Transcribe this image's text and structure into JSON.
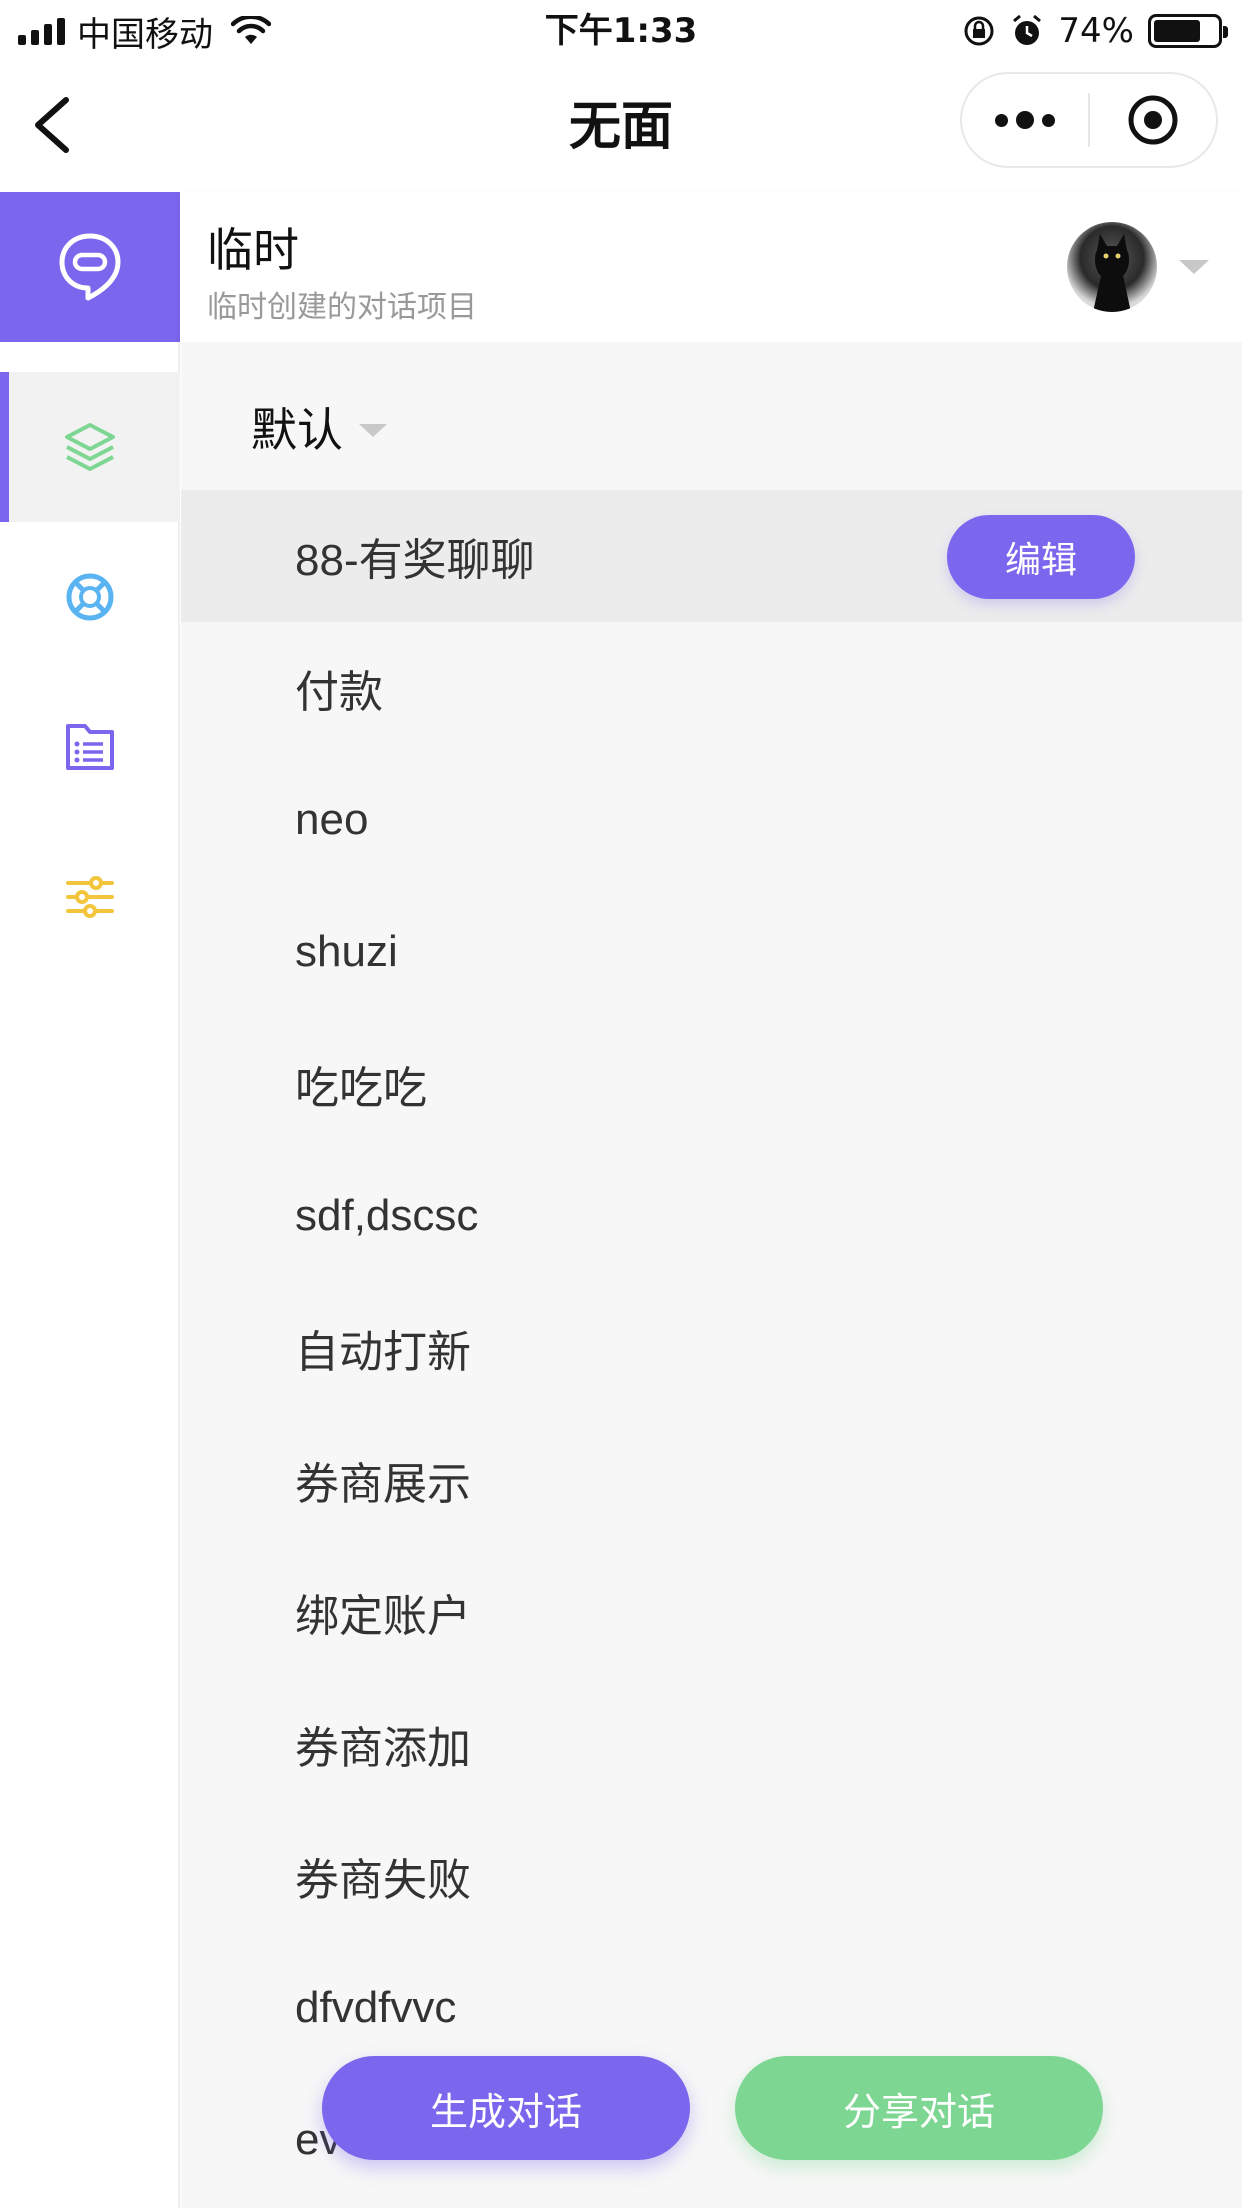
{
  "status_bar": {
    "carrier": "中国移动",
    "time": "下午1:33",
    "battery_percent": "74%",
    "battery_level": 0.74
  },
  "nav": {
    "title": "无面"
  },
  "project": {
    "title": "临时",
    "subtitle": "临时创建的对话项目"
  },
  "sidebar": {
    "items": [
      {
        "icon": "layers-icon",
        "color": "#7ed693",
        "active": true
      },
      {
        "icon": "lifebuoy-icon",
        "color": "#5ab4f2",
        "active": false
      },
      {
        "icon": "document-list-icon",
        "color": "#7b67ee",
        "active": false
      },
      {
        "icon": "sliders-icon",
        "color": "#f2c53c",
        "active": false
      }
    ]
  },
  "group": {
    "title": "默认"
  },
  "conversations": [
    "88-有奖聊聊",
    "付款",
    "neo",
    "shuzi",
    "吃吃吃",
    "sdf,dscsc",
    "自动打新",
    "券商展示",
    "绑定账户",
    "券商添加",
    "券商失败",
    "dfvdfvvc",
    "evevevev"
  ],
  "edit_label": "编辑",
  "buttons": {
    "generate": "生成对话",
    "share": "分享对话"
  },
  "colors": {
    "accent": "#7b67ee",
    "green": "#7ed693",
    "blue": "#5ab4f2",
    "yellow": "#f2c53c"
  }
}
